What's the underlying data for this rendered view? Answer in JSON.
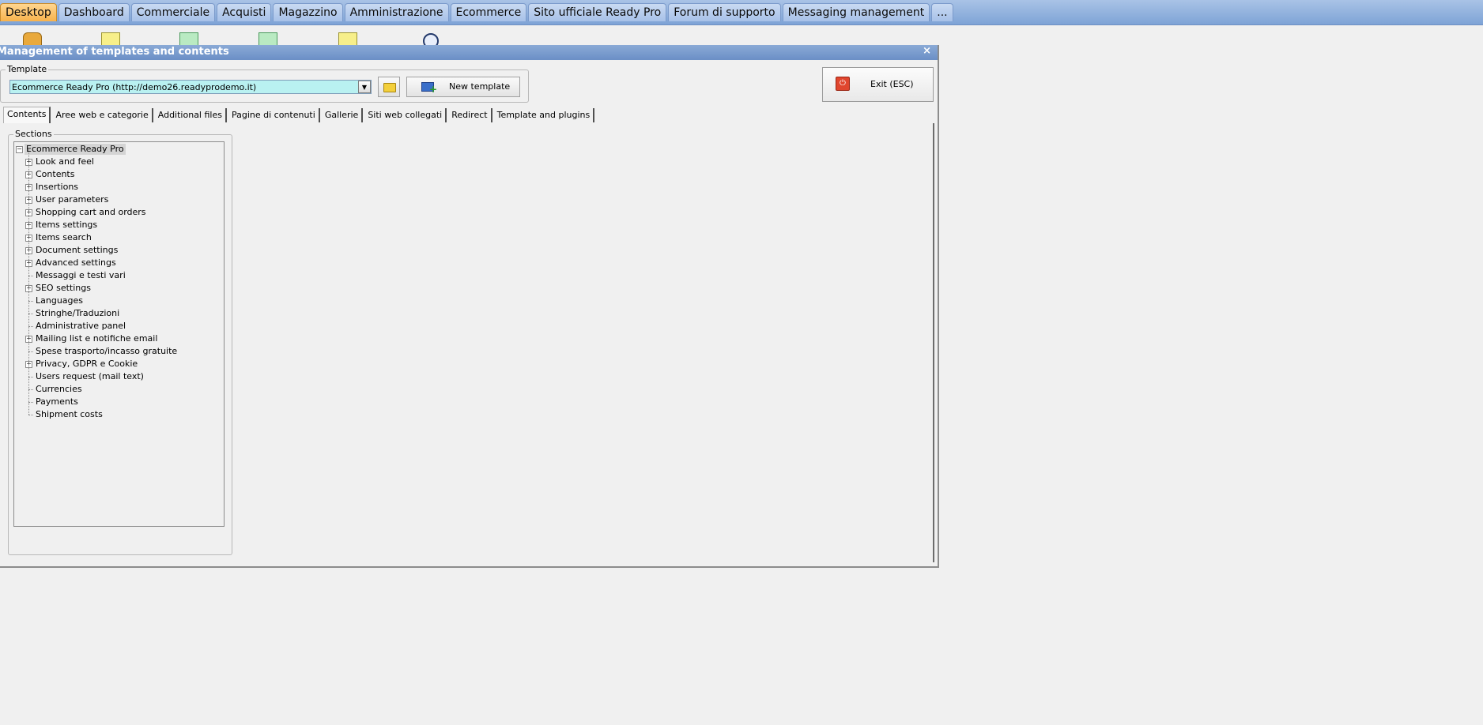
{
  "top_tabs": [
    {
      "label": "Desktop",
      "active": true
    },
    {
      "label": "Dashboard"
    },
    {
      "label": "Commerciale"
    },
    {
      "label": "Acquisti"
    },
    {
      "label": "Magazzino"
    },
    {
      "label": "Amministrazione"
    },
    {
      "label": "Ecommerce"
    },
    {
      "label": "Sito ufficiale Ready Pro"
    },
    {
      "label": "Forum di supporto"
    },
    {
      "label": "Messaging management"
    },
    {
      "label": "..."
    }
  ],
  "window": {
    "title": "Management of templates and contents",
    "close_glyph": "×"
  },
  "template_group": {
    "legend": "Template",
    "selected_value": "Ecommerce Ready Pro (http://demo26.readyprodemo.it)",
    "new_template_label": "New template"
  },
  "exit_label": "Exit (ESC)",
  "tabs": [
    {
      "label": "Contents",
      "active": true
    },
    {
      "label": "Aree web e categorie"
    },
    {
      "label": "Additional files"
    },
    {
      "label": "Pagine di contenuti"
    },
    {
      "label": "Gallerie"
    },
    {
      "label": "Siti web collegati"
    },
    {
      "label": "Redirect"
    },
    {
      "label": "Template and plugins"
    }
  ],
  "sections": {
    "legend": "Sections",
    "root": "Ecommerce Ready Pro",
    "items": [
      {
        "label": "Look and feel",
        "expandable": true
      },
      {
        "label": "Contents",
        "expandable": true
      },
      {
        "label": "Insertions",
        "expandable": true
      },
      {
        "label": "User parameters",
        "expandable": true
      },
      {
        "label": "Shopping cart and orders",
        "expandable": true
      },
      {
        "label": "Items settings",
        "expandable": true
      },
      {
        "label": "Items search",
        "expandable": true
      },
      {
        "label": "Document settings",
        "expandable": true
      },
      {
        "label": "Advanced settings",
        "expandable": true
      },
      {
        "label": "Messaggi e testi vari",
        "expandable": false
      },
      {
        "label": "SEO settings",
        "expandable": true
      },
      {
        "label": "Languages",
        "expandable": false
      },
      {
        "label": "Stringhe/Traduzioni",
        "expandable": false
      },
      {
        "label": "Administrative panel",
        "expandable": false
      },
      {
        "label": "Mailing list e notifiche email",
        "expandable": true
      },
      {
        "label": "Spese trasporto/incasso gratuite",
        "expandable": false
      },
      {
        "label": "Privacy, GDPR e Cookie",
        "expandable": true
      },
      {
        "label": "Users request (mail text)",
        "expandable": false
      },
      {
        "label": "Currencies",
        "expandable": false
      },
      {
        "label": "Payments",
        "expandable": false
      },
      {
        "label": "Shipment costs",
        "expandable": false
      }
    ]
  }
}
